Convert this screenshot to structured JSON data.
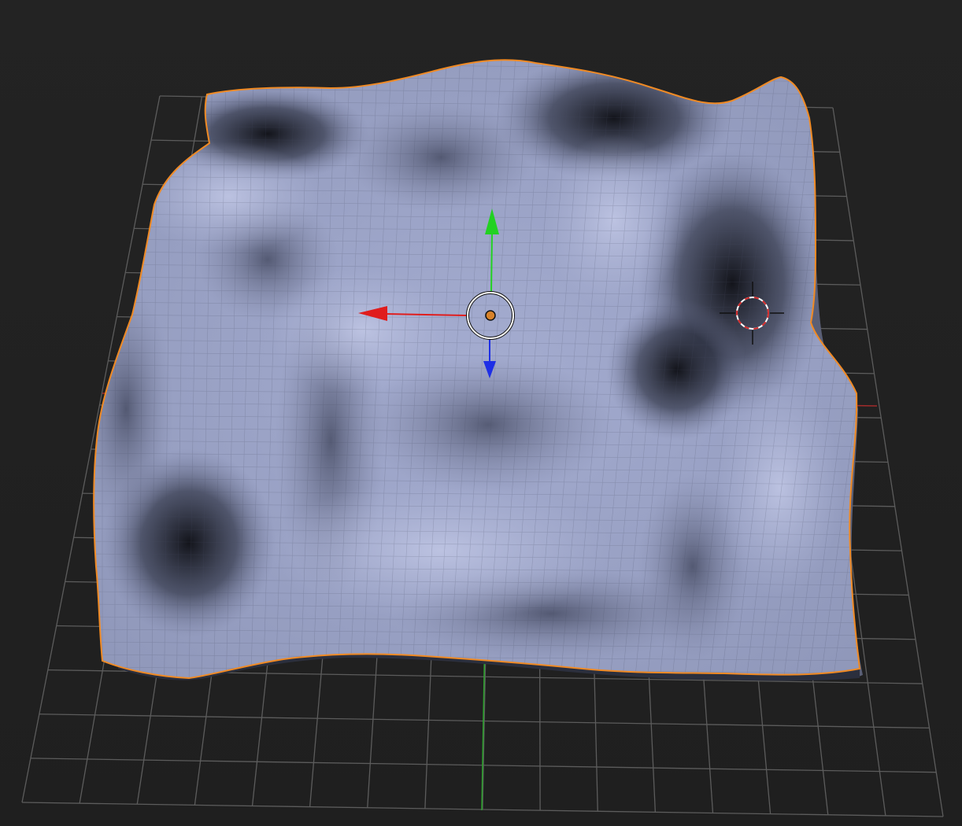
{
  "viewport": {
    "mode": "object",
    "shading": "solid",
    "background_color": "#222222"
  },
  "grid": {
    "visible": true,
    "line_color": "#5c5c5c",
    "x_axis_color": "#a12b2b",
    "y_axis_color": "#2ea02e"
  },
  "object": {
    "type": "mesh",
    "shape": "displaced-plane",
    "selected": true,
    "outline_color": "#f08a24",
    "surface_color": "#a4acd0",
    "shadow_color": "#0c0d12"
  },
  "gizmo": {
    "type": "translate",
    "x_axis_color": "#e01d1d",
    "y_axis_color": "#22d122",
    "z_axis_color": "#1e2fe6",
    "origin_color": "#d8822a",
    "ring_color": "#ffffff"
  },
  "cursor_3d": {
    "visible": true,
    "ring_colors": [
      "#ffffff",
      "#d42a2a"
    ]
  }
}
